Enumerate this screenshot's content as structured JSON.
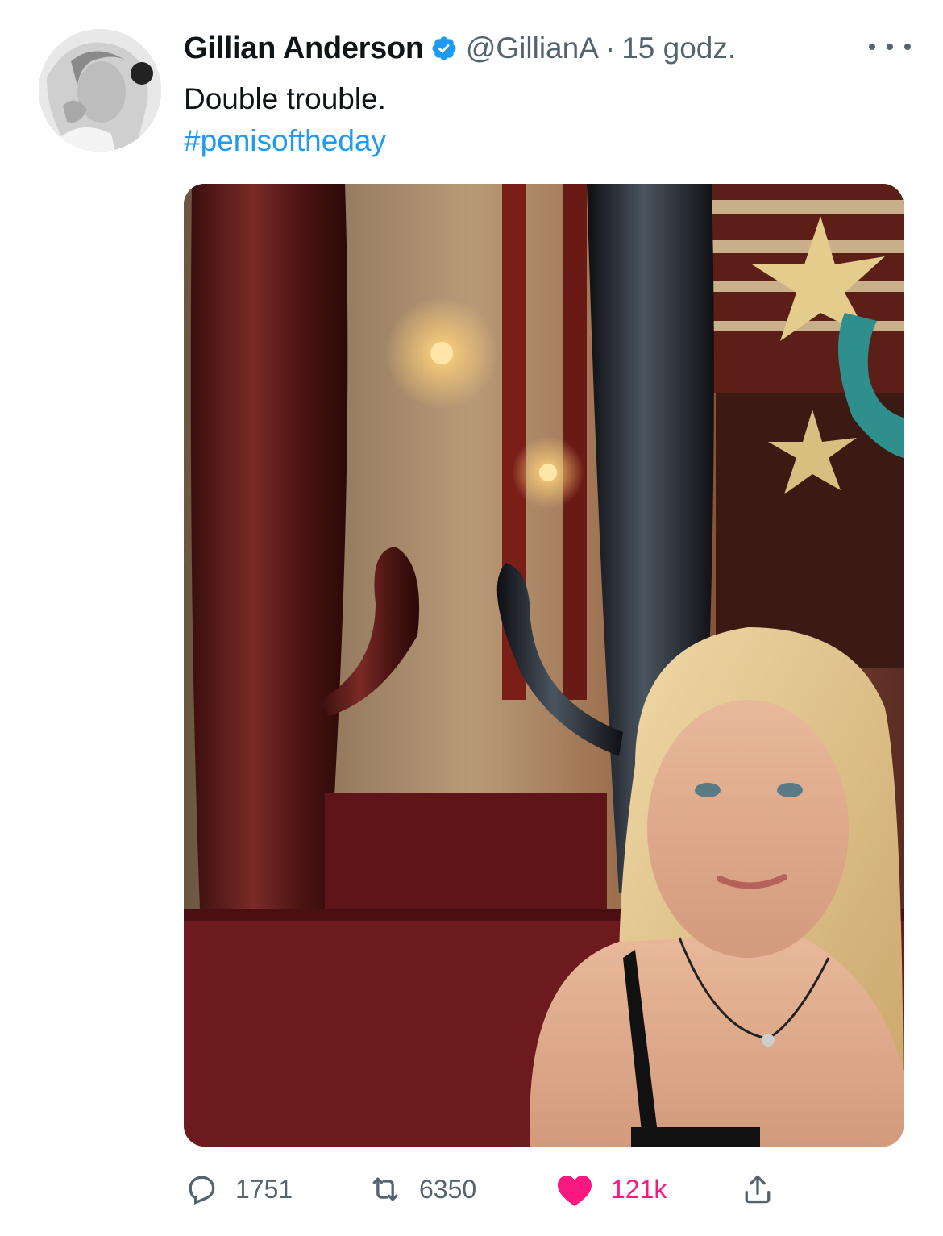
{
  "tweet": {
    "author_name": "Gillian Anderson",
    "handle": "@GillianA",
    "separator": "·",
    "time": "15 godz.",
    "text": "Double trouble.",
    "hashtag": "#penisoftheday"
  },
  "actions": {
    "replies": "1751",
    "retweets": "6350",
    "likes": "121k"
  },
  "colors": {
    "link": "#1d9bf0",
    "like": "#f91880",
    "verified": "#1d9bf0",
    "muted": "#536471"
  },
  "icons": {
    "verified": "verified-badge-icon",
    "more": "more-dots-icon",
    "reply": "reply-icon",
    "retweet": "retweet-icon",
    "like": "heart-icon",
    "share": "share-icon"
  }
}
